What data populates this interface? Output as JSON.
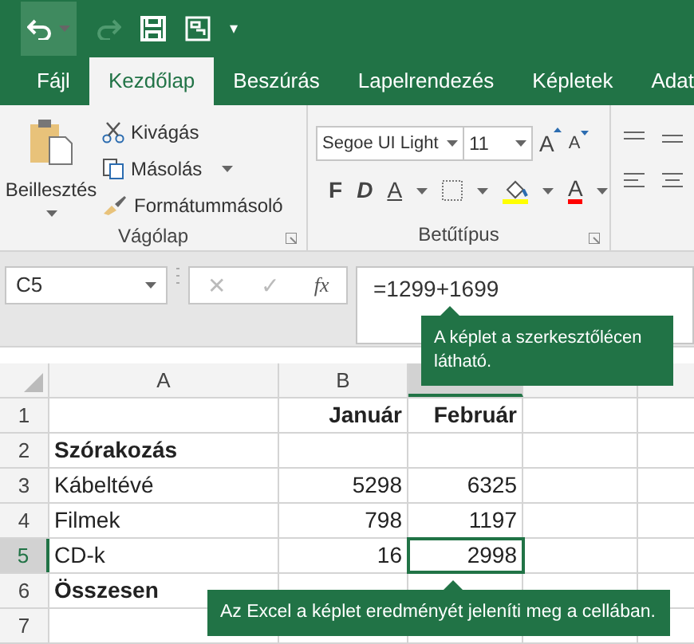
{
  "quick_access": {
    "more": "▾"
  },
  "tabs": [
    {
      "label": "Fájl",
      "selected": false
    },
    {
      "label": "Kezdőlap",
      "selected": true
    },
    {
      "label": "Beszúrás",
      "selected": false
    },
    {
      "label": "Lapelrendezés",
      "selected": false
    },
    {
      "label": "Képletek",
      "selected": false
    },
    {
      "label": "Adat",
      "selected": false
    }
  ],
  "clipboard": {
    "paste": "Beillesztés",
    "cut": "Kivágás",
    "copy": "Másolás",
    "painter": "Formátummásoló",
    "group_label": "Vágólap"
  },
  "font": {
    "name": "Segoe UI Light",
    "size": "11",
    "grow": "A",
    "shrink": "A",
    "bold": "F",
    "italic": "D",
    "underline": "A",
    "font_color": "A",
    "group_label": "Betűtípus"
  },
  "name_box": "C5",
  "formula_bar": {
    "cancel": "✕",
    "enter": "✓",
    "function": "fx",
    "value": "=1299+1699"
  },
  "columns": [
    {
      "label": "A",
      "selected": false
    },
    {
      "label": "B",
      "selected": false
    },
    {
      "selected": true
    },
    {
      "selected": false
    }
  ],
  "rows": [
    {
      "number": "1",
      "selected": false,
      "cells": [
        "",
        "Január",
        "Február"
      ],
      "bold": true
    },
    {
      "number": "2",
      "selected": false,
      "cells": [
        "Szórakozás",
        "",
        ""
      ],
      "bold": true
    },
    {
      "number": "3",
      "selected": false,
      "cells": [
        "Kábeltévé",
        "5298",
        "6325"
      ],
      "bold": false
    },
    {
      "number": "4",
      "selected": false,
      "cells": [
        "Filmek",
        "798",
        "1197"
      ],
      "bold": false
    },
    {
      "number": "5",
      "selected": true,
      "cells": [
        "CD-k",
        "16",
        "2998"
      ],
      "bold": false
    },
    {
      "number": "6",
      "selected": false,
      "cells": [
        "Összesen",
        "",
        ""
      ],
      "bold": true
    },
    {
      "number": "7",
      "selected": false,
      "cells": [
        "",
        "",
        ""
      ]
    }
  ],
  "callouts": [
    {
      "text": "A képlet a szerkesztőlécen látható."
    },
    {
      "text": "Az Excel a képlet eredményét jeleníti meg a cellában."
    }
  ]
}
